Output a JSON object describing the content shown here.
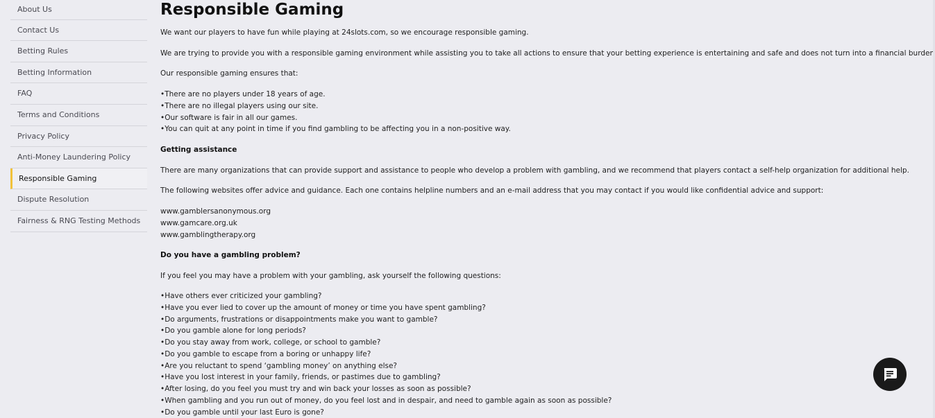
{
  "sidebar": {
    "items": [
      {
        "label": "About Us"
      },
      {
        "label": "Contact Us"
      },
      {
        "label": "Betting Rules"
      },
      {
        "label": "Betting Information"
      },
      {
        "label": "FAQ"
      },
      {
        "label": "Terms and Conditions"
      },
      {
        "label": "Privacy Policy"
      },
      {
        "label": "Anti-Money Laundering Policy"
      },
      {
        "label": "Responsible Gaming"
      },
      {
        "label": "Dispute Resolution"
      },
      {
        "label": "Fairness & RNG Testing Methods"
      }
    ],
    "active_item": "Responsible Gaming",
    "active_accent": "#f1c23a"
  },
  "main": {
    "title": "Responsible Gaming",
    "intro1": "We want our players to have fun while playing at 24slots.com, so we encourage responsible gaming.",
    "intro2": "We are trying to provide you with a responsible gaming environment while assisting you to take all actions to ensure that your betting experience is entertaining and safe and does not turn into a financial burden.",
    "ensures_label": "Our responsible gaming ensures that:",
    "ensures": [
      "There are no players under 18 years of age.",
      "There are no illegal players using our site.",
      "Our software is fair in all our games.",
      "You can quit at any point in time if you find gambling to be affecting you in a non-positive way."
    ],
    "assist_heading": "Getting assistance",
    "assist1": "There are many organizations that can provide support and assistance to people who develop a problem with gambling, and we recommend that players contact a self-help organization for additional help.",
    "assist2": "The following websites offer advice and guidance. Each one contains helpline numbers and an e-mail address that you may contact if you would like confidential advice and support:",
    "links": [
      "www.gamblersanonymous.org",
      "www.gamcare.org.uk",
      "www.gamblingtherapy.org"
    ],
    "problem_heading": "Do you have a gambling problem?",
    "problem_intro": "If you feel you may have a problem with your gambling, ask yourself the following questions:",
    "questions": [
      "Have others ever criticized your gambling?",
      "Have you ever lied to cover up the amount of money or time you have spent gambling?",
      "Do arguments, frustrations or disappointments make you want to gamble?",
      "Do you gamble alone for long periods?",
      "Do you stay away from work, college, or school to gamble?",
      "Do you gamble to escape from a boring or unhappy life?",
      "Are you reluctant to spend ‘gambling money’ on anything else?",
      "Have you lost interest in your family, friends, or pastimes due to gambling?",
      "After losing, do you feel you must try and win back your losses as soon as possible?",
      "When gambling and you run out of money, do you feel lost and in despair, and need to gamble again as soon as possible?",
      "Do you gamble until your last Euro is gone?"
    ]
  },
  "chat": {
    "icon": "chat-bubble-icon",
    "color": "#1a1a1a"
  }
}
